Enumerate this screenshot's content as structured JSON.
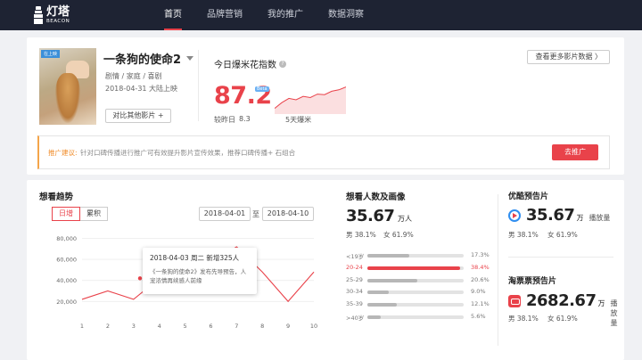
{
  "header": {
    "logo_cn": "灯塔",
    "logo_en": "BEACON",
    "nav": [
      {
        "label": "首页",
        "active": true
      },
      {
        "label": "品牌营销",
        "active": false
      },
      {
        "label": "我的推广",
        "active": false
      },
      {
        "label": "数据洞察",
        "active": false
      }
    ]
  },
  "film": {
    "poster_tag": "在上映",
    "title": "一条狗的使命2",
    "genre": "剧情 / 家庭 / 喜剧",
    "release": "2018-04-31  大陆上映",
    "compare_label": "对比其他影片  +",
    "more_label": "查看更多影片数据  〉"
  },
  "index": {
    "title": "今日爆米花指数",
    "value": "87.2",
    "beta": "Beta",
    "sub_a": "较昨日",
    "sub_b": "8.3",
    "sub_c": "5天爆米",
    "sparkline": [
      0.2,
      0.4,
      0.55,
      0.5,
      0.62,
      0.58,
      0.7,
      0.68,
      0.8,
      0.85,
      0.95
    ]
  },
  "suggestion": {
    "label": "推广建议:",
    "text": "针对口碑传播进行推广可有效提升影片宣传效果，推荐口碑传播+  石组合",
    "button": "去推广"
  },
  "trend": {
    "title": "想看趋势",
    "toggle_on": "日增",
    "toggle_off": "累积",
    "date_from": "2018-04-01",
    "date_sep": "至",
    "date_to": "2018-04-10",
    "tooltip_head": "2018-04-03 周二  新增325人",
    "tooltip_body": "《一条狗的使命2》发布先导预告，人宠浓情再续感人前缘",
    "chart_data": {
      "type": "line",
      "x": [
        1,
        2,
        3,
        4,
        5,
        6,
        7,
        8,
        9,
        10
      ],
      "values": [
        22000,
        30000,
        22000,
        42000,
        52000,
        56000,
        72000,
        48000,
        20000,
        48000
      ],
      "highlight_point": [
        3.25,
        42000
      ],
      "yticks": [
        "80,000",
        "60,000",
        "40,000",
        "20,000"
      ],
      "ytick_values": [
        80000,
        60000,
        40000,
        20000
      ],
      "ylim": [
        5000,
        88000
      ],
      "xlim": [
        1,
        10
      ],
      "color": "#e9424a"
    }
  },
  "audience": {
    "title": "想看人数及画像",
    "total": "35.67",
    "unit": "万人",
    "male": "男 38.1%",
    "female": "女 61.9%",
    "ages": [
      {
        "label": "<19岁",
        "pct": "17.3%",
        "value": 17.3,
        "hl": false
      },
      {
        "label": "20-24",
        "pct": "38.4%",
        "value": 38.4,
        "hl": true
      },
      {
        "label": "25-29",
        "pct": "20.6%",
        "value": 20.6,
        "hl": false
      },
      {
        "label": "30-34",
        "pct": "9.0%",
        "value": 9.0,
        "hl": false
      },
      {
        "label": "35-39",
        "pct": "12.1%",
        "value": 12.1,
        "hl": false
      },
      {
        "label": ">40岁",
        "pct": "5.6%",
        "value": 5.6,
        "hl": false
      }
    ]
  },
  "youku": {
    "title": "优酷预告片",
    "value": "35.67",
    "unit": "万",
    "play": "播放量",
    "male": "男  38.1%",
    "female": "女  61.9%"
  },
  "taopiao": {
    "title": "淘票票预告片",
    "value": "2682.67",
    "unit": "万",
    "play": "播放量",
    "male": "男  38.1%",
    "female": "女  61.9%"
  }
}
